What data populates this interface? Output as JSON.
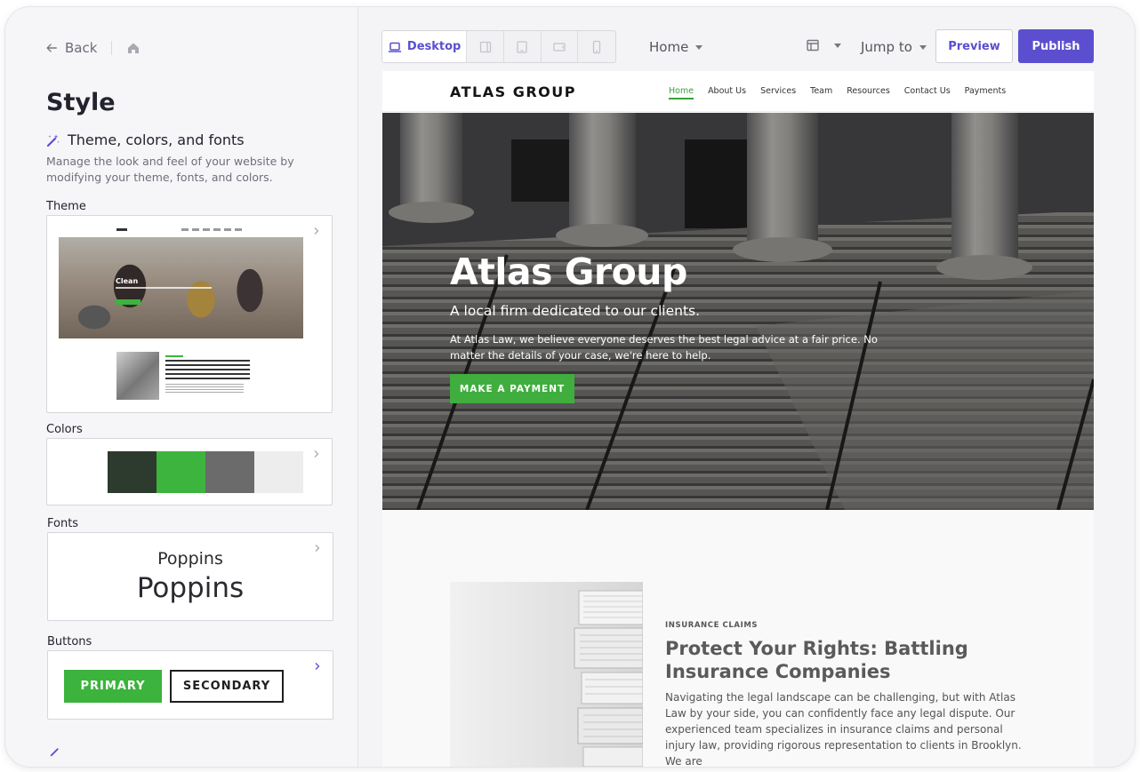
{
  "sidebar": {
    "back_label": "Back",
    "title": "Style",
    "section_heading": "Theme, colors, and fonts",
    "section_description": "Manage the look and feel of your website by modifying your theme, fonts, and colors.",
    "theme": {
      "label": "Theme",
      "preview_name": "Clean"
    },
    "colors": {
      "label": "Colors",
      "swatches": [
        "#2d3a2e",
        "#3db43d",
        "#6b6b6b",
        "#ededee"
      ]
    },
    "fonts": {
      "label": "Fonts",
      "heading_font": "Poppins",
      "body_font": "Poppins"
    },
    "buttons": {
      "label": "Buttons",
      "primary_label": "PRIMARY",
      "secondary_label": "SECONDARY"
    }
  },
  "toolbar": {
    "device_label": "Desktop",
    "page_select": "Home",
    "jump_label": "Jump to",
    "preview_label": "Preview",
    "publish_label": "Publish"
  },
  "site": {
    "logo": "ATLAS GROUP",
    "nav": [
      "Home",
      "About Us",
      "Services",
      "Team",
      "Resources",
      "Contact Us",
      "Payments"
    ],
    "active_nav": "Home",
    "hero": {
      "title": "Atlas Group",
      "subtitle": "A local firm dedicated to our clients.",
      "body": "At Atlas Law, we believe everyone deserves the best legal advice at a fair price. No matter the details of your case, we're here to help.",
      "cta": "MAKE A PAYMENT"
    },
    "section": {
      "kicker": "INSURANCE CLAIMS",
      "title": "Protect Your Rights: Battling Insurance Companies",
      "body": "Navigating the legal landscape can be challenging, but with Atlas Law by your side, you can confidently face any legal dispute. Our experienced team specializes in insurance claims and personal injury law, providing rigorous representation to clients in Brooklyn. We are"
    }
  },
  "colors": {
    "accent": "#5b4fd0",
    "brand_green": "#3fae3f"
  }
}
